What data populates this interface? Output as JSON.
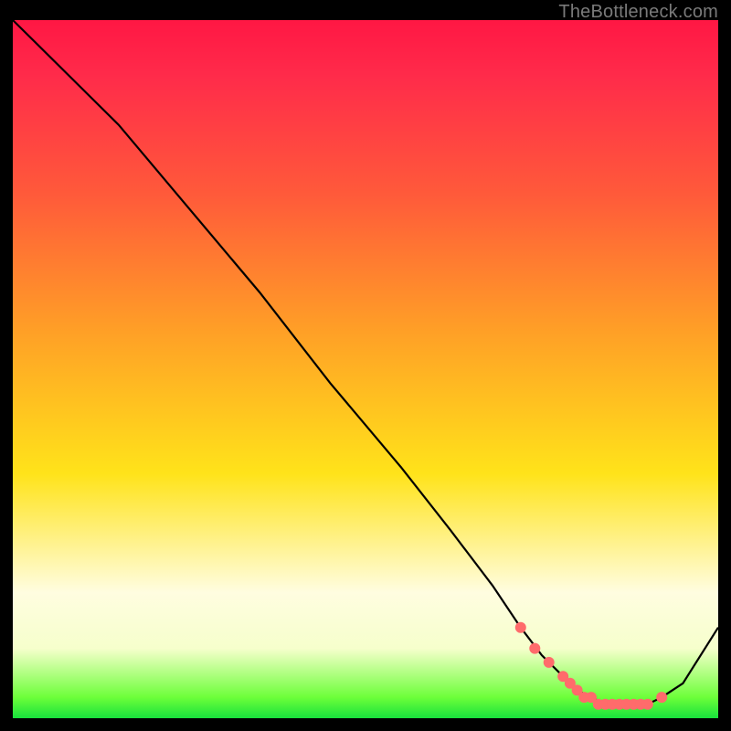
{
  "watermark": "TheBottleneck.com",
  "chart_data": {
    "type": "line",
    "title": "",
    "xlabel": "",
    "ylabel": "",
    "xlim": [
      0,
      100
    ],
    "ylim": [
      0,
      100
    ],
    "series": [
      {
        "name": "curve",
        "x": [
          0,
          3,
          8,
          15,
          25,
          35,
          45,
          55,
          62,
          68,
          72,
          75,
          78,
          80,
          82,
          84,
          86,
          88,
          90,
          92,
          95,
          100
        ],
        "values": [
          100,
          97,
          92,
          85,
          73,
          61,
          48,
          36,
          27,
          19,
          13,
          9,
          6,
          4,
          3,
          2,
          2,
          2,
          2,
          3,
          5,
          13
        ]
      }
    ],
    "markers": {
      "name": "highlight-points",
      "color": "#ff6b6b",
      "x": [
        72,
        74,
        76,
        78,
        79,
        80,
        81,
        82,
        83,
        84,
        85,
        86,
        87,
        88,
        89,
        90,
        92
      ],
      "values": [
        13,
        10,
        8,
        6,
        5,
        4,
        3,
        3,
        2,
        2,
        2,
        2,
        2,
        2,
        2,
        2,
        3
      ]
    }
  }
}
